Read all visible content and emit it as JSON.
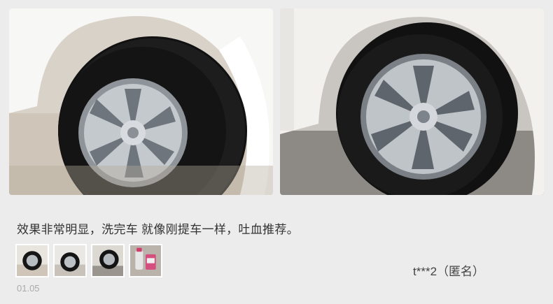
{
  "review": {
    "text": "效果非常明显，洗完车 就像刚提车一样，吐血推荐。",
    "author": "t***2（匿名）",
    "date": "01.05"
  },
  "photos": [
    {
      "icon": "car-wheel-photo"
    },
    {
      "icon": "car-wheel-photo"
    }
  ],
  "thumbnails": [
    {
      "icon": "wheel-thumbnail"
    },
    {
      "icon": "wheel-thumbnail"
    },
    {
      "icon": "wheel-thumbnail"
    },
    {
      "icon": "product-thumbnail"
    }
  ],
  "colors": {
    "background": "#ececec",
    "text": "#333333",
    "muted": "#aaaaaa"
  }
}
